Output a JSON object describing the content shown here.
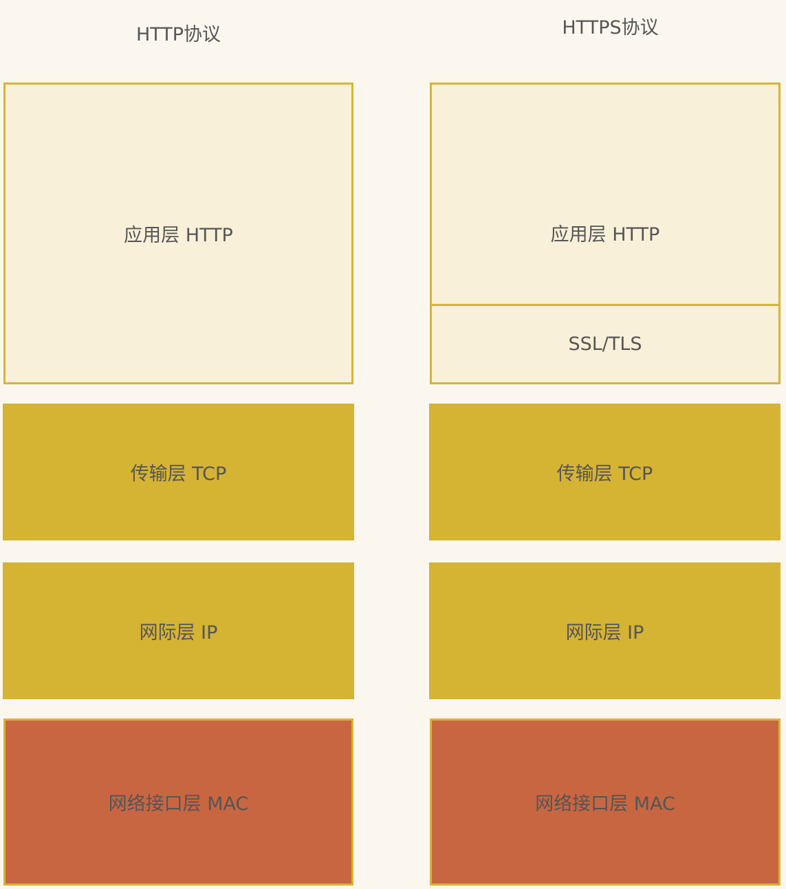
{
  "http_stack": {
    "title": "HTTP协议",
    "application": "应用层 HTTP",
    "transport": "传输层 TCP",
    "internet": "网际层 IP",
    "network_interface": "网络接口层 MAC"
  },
  "https_stack": {
    "title": "HTTPS协议",
    "application": "应用层 HTTP",
    "security": "SSL/TLS",
    "transport": "传输层 TCP",
    "internet": "网际层 IP",
    "network_interface": "网络接口层 MAC"
  },
  "colors": {
    "background": "#fbf7ef",
    "application_fill": "#f8f0d8",
    "border": "#d6b535",
    "transport_internet_fill": "#d5b333",
    "network_interface_fill": "#c96642",
    "text": "#555555"
  }
}
